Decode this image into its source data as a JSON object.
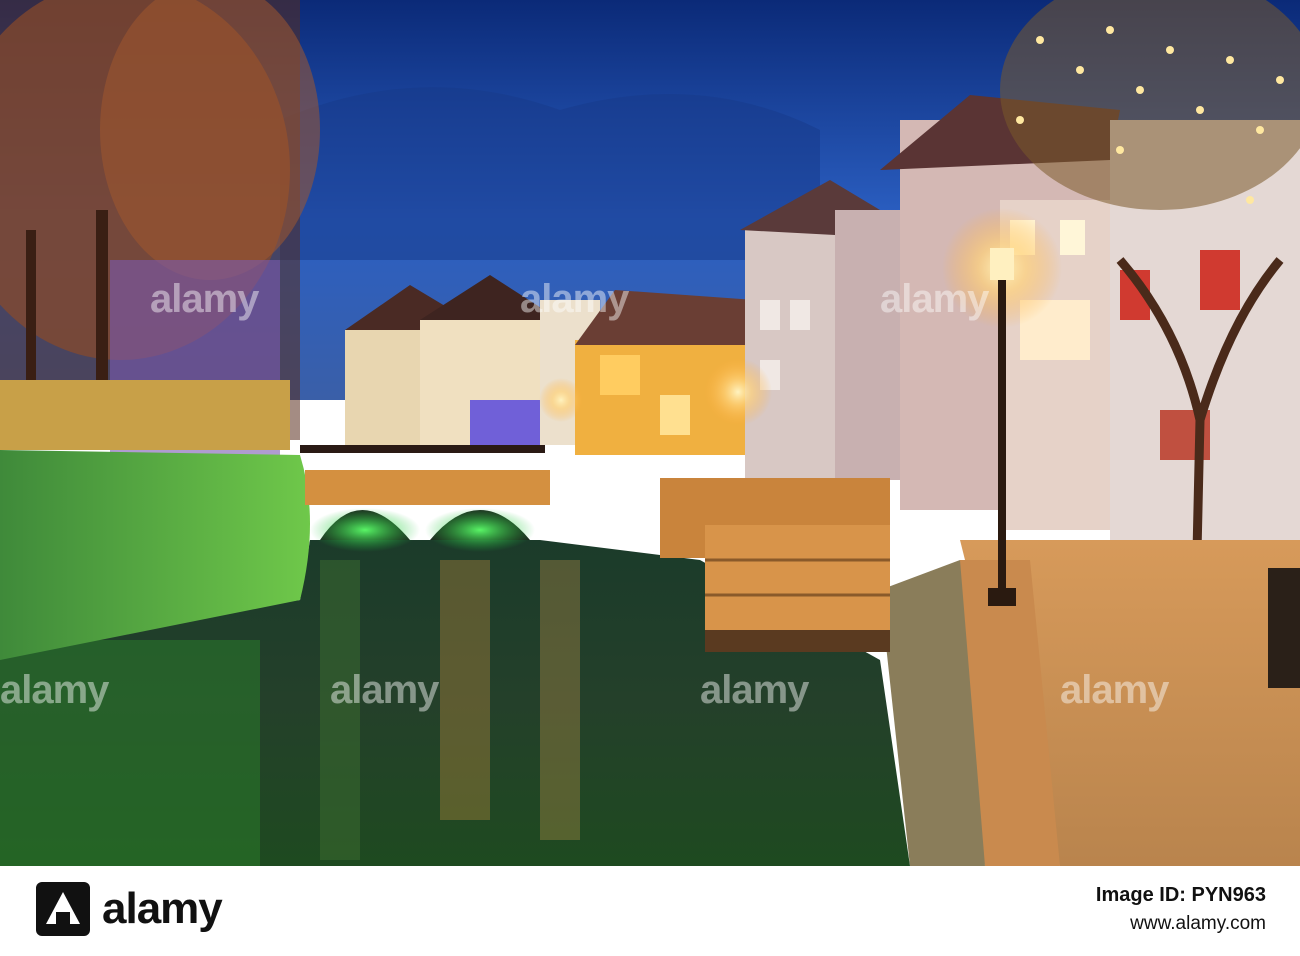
{
  "footer": {
    "brand": "alamy",
    "image_id": "Image ID: PYN963",
    "site": "www.alamy.com"
  },
  "watermark": {
    "text": "alamy"
  },
  "colors": {
    "sky_top": "#0a2a7a",
    "sky_bottom": "#3b6fd0",
    "water_green": "#1dbf3a",
    "lamp_glow": "#ffd27a",
    "brand_black": "#111111"
  },
  "icons": {
    "brand_mark": "alamy-logo-icon"
  }
}
